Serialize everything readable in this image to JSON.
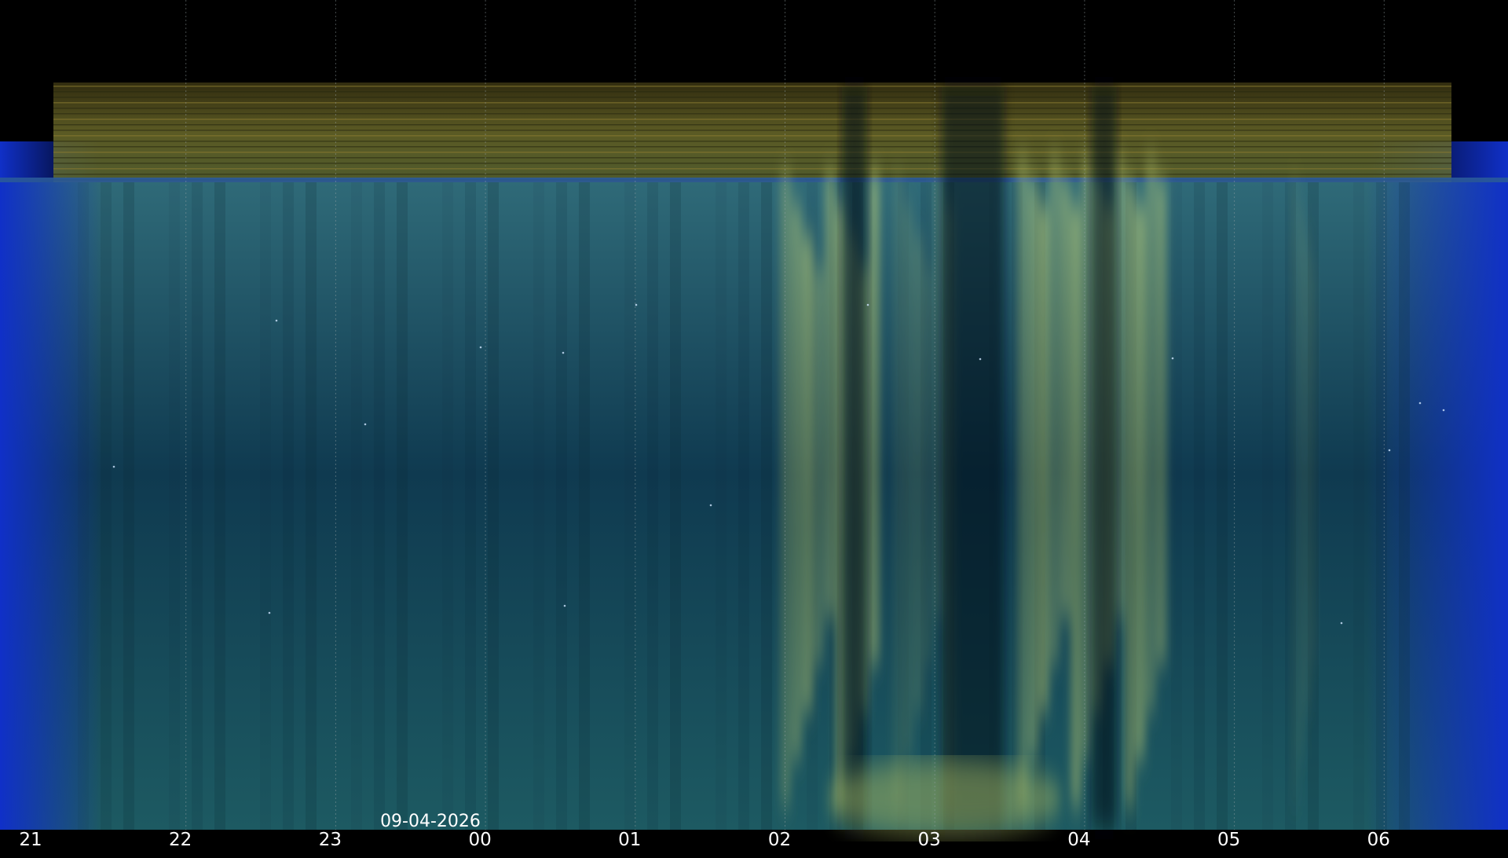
{
  "chart_data": {
    "type": "heatmap",
    "title": "",
    "xlabel": "",
    "ylabel": "",
    "date": "09-04-2026",
    "x_ticks": [
      "21",
      "22",
      "23",
      "00",
      "01",
      "02",
      "03",
      "04",
      "05",
      "06"
    ],
    "x_range_hours": [
      21.0,
      30.95
    ],
    "vertical_gridlines": true,
    "colors": {
      "background": "#000000",
      "sky_upper": "#2f6a78",
      "sky_lower": "#0f3a50",
      "twilight_blue": "#1030c8",
      "aurora": "#c8d878",
      "horizon_band": "#6b6a2a",
      "gridline": "#9aa6a8"
    },
    "bright_bands": [
      {
        "start": "02:00",
        "end": "02:40",
        "intensity": 0.9
      },
      {
        "start": "03:35",
        "end": "04:35",
        "intensity": 0.95
      },
      {
        "start": "02:45",
        "end": "03:10",
        "intensity": 0.35
      },
      {
        "start": "05:25",
        "end": "05:35",
        "intensity": 0.25
      }
    ],
    "dark_gaps": [
      {
        "start": "02:25",
        "end": "02:35"
      },
      {
        "start": "03:05",
        "end": "03:30"
      },
      {
        "start": "04:05",
        "end": "04:15"
      }
    ]
  }
}
